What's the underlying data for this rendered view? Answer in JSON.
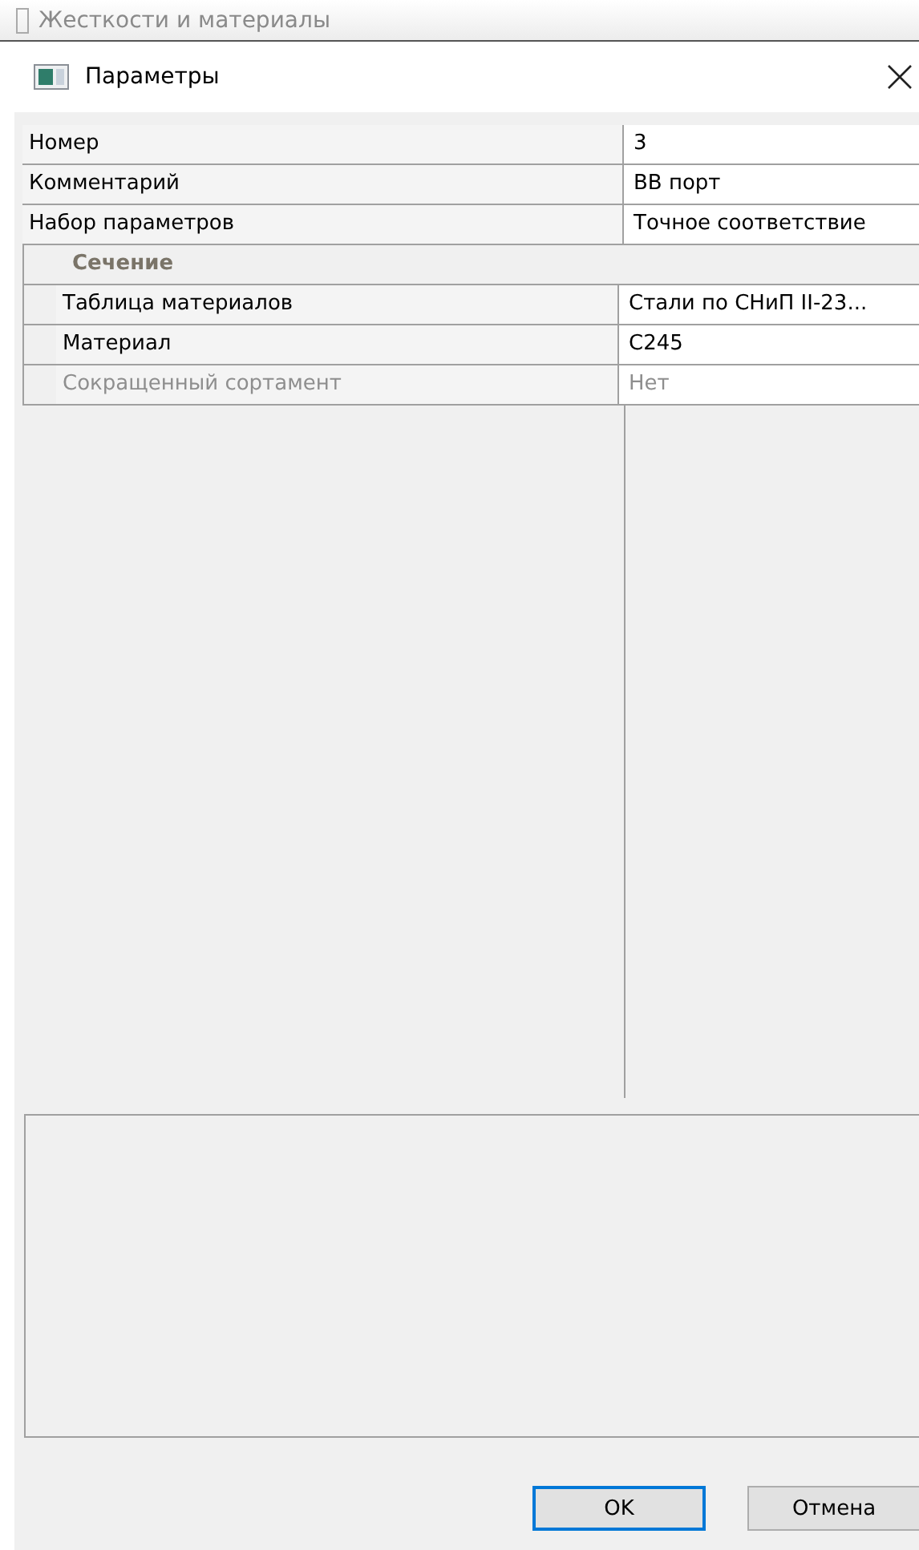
{
  "background_window": {
    "title": "Жесткости и материалы"
  },
  "window": {
    "title": "Параметры"
  },
  "properties": [
    {
      "kind": "property",
      "name": "Номер",
      "value": "3",
      "disabled": false
    },
    {
      "kind": "property",
      "name": "Комментарий",
      "value": "ВВ порт",
      "disabled": false
    },
    {
      "kind": "property",
      "name": "Набор параметров",
      "value": "Точное соответствие",
      "disabled": false
    },
    {
      "kind": "group",
      "name": "Сечение",
      "children": [
        {
          "name": "Таблица материалов",
          "value": "Стали по СНиП II-23...",
          "disabled": false
        },
        {
          "name": "Материал",
          "value": "С245",
          "disabled": false
        },
        {
          "name": "Сокращенный сортамент",
          "value": "Нет",
          "disabled": true
        }
      ]
    }
  ],
  "buttons": [
    {
      "label": "OK",
      "default": true
    },
    {
      "label": "Отмена",
      "default": false
    }
  ]
}
